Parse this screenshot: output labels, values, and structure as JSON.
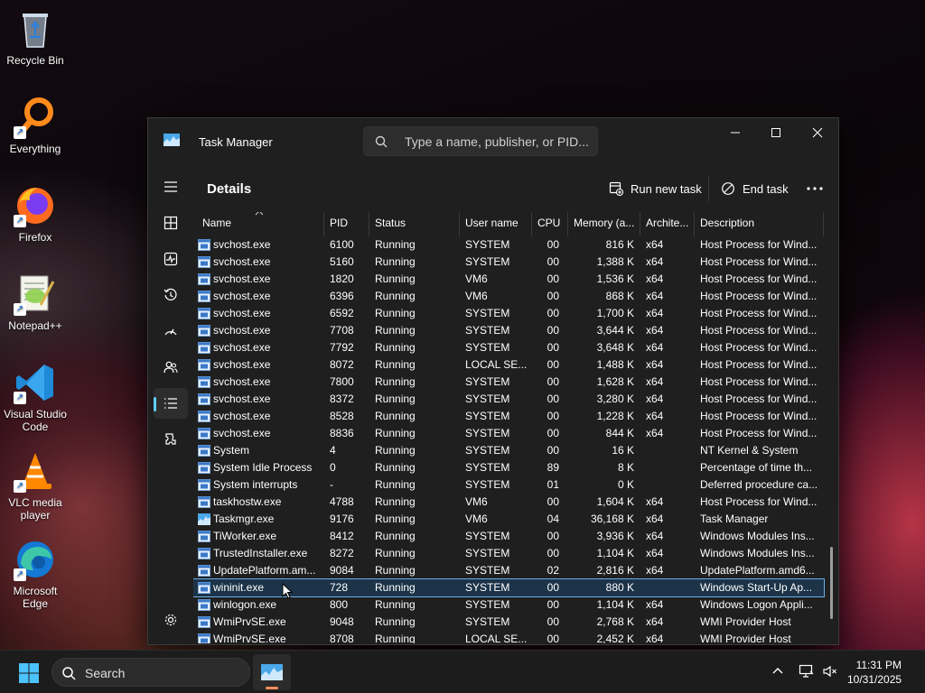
{
  "desktop": {
    "icons": [
      {
        "label": "Recycle Bin",
        "icon": "recycle-bin-icon"
      },
      {
        "label": "Everything",
        "icon": "everything-icon"
      },
      {
        "label": "Firefox",
        "icon": "firefox-icon"
      },
      {
        "label": "Notepad++",
        "icon": "notepad-plus-plus-icon"
      },
      {
        "label": "Visual Studio Code",
        "icon": "vscode-icon"
      },
      {
        "label": "VLC media player",
        "icon": "vlc-icon"
      },
      {
        "label": "Microsoft Edge",
        "icon": "edge-icon"
      }
    ]
  },
  "window": {
    "title": "Task Manager",
    "search_placeholder": "Type a name, publisher, or PID...",
    "page_title": "Details",
    "run_new_task_label": "Run new task",
    "end_task_label": "End task",
    "active_nav": "details"
  },
  "sidebar": {
    "items": [
      "hamburger-menu",
      "processes",
      "performance",
      "app-history",
      "startup-apps",
      "users",
      "details",
      "services",
      "settings"
    ]
  },
  "table": {
    "columns": [
      "Name",
      "PID",
      "Status",
      "User name",
      "CPU",
      "Memory (a...",
      "Archite...",
      "Description"
    ],
    "sorted_by": "Name",
    "rows": [
      {
        "name": "svchost.exe",
        "pid": "6100",
        "status": "Running",
        "user": "SYSTEM",
        "cpu": "00",
        "mem": "816 K",
        "arch": "x64",
        "desc": "Host Process for Wind..."
      },
      {
        "name": "svchost.exe",
        "pid": "5160",
        "status": "Running",
        "user": "SYSTEM",
        "cpu": "00",
        "mem": "1,388 K",
        "arch": "x64",
        "desc": "Host Process for Wind..."
      },
      {
        "name": "svchost.exe",
        "pid": "1820",
        "status": "Running",
        "user": "VM6",
        "cpu": "00",
        "mem": "1,536 K",
        "arch": "x64",
        "desc": "Host Process for Wind..."
      },
      {
        "name": "svchost.exe",
        "pid": "6396",
        "status": "Running",
        "user": "VM6",
        "cpu": "00",
        "mem": "868 K",
        "arch": "x64",
        "desc": "Host Process for Wind..."
      },
      {
        "name": "svchost.exe",
        "pid": "6592",
        "status": "Running",
        "user": "SYSTEM",
        "cpu": "00",
        "mem": "1,700 K",
        "arch": "x64",
        "desc": "Host Process for Wind..."
      },
      {
        "name": "svchost.exe",
        "pid": "7708",
        "status": "Running",
        "user": "SYSTEM",
        "cpu": "00",
        "mem": "3,644 K",
        "arch": "x64",
        "desc": "Host Process for Wind..."
      },
      {
        "name": "svchost.exe",
        "pid": "7792",
        "status": "Running",
        "user": "SYSTEM",
        "cpu": "00",
        "mem": "3,648 K",
        "arch": "x64",
        "desc": "Host Process for Wind..."
      },
      {
        "name": "svchost.exe",
        "pid": "8072",
        "status": "Running",
        "user": "LOCAL SE...",
        "cpu": "00",
        "mem": "1,488 K",
        "arch": "x64",
        "desc": "Host Process for Wind..."
      },
      {
        "name": "svchost.exe",
        "pid": "7800",
        "status": "Running",
        "user": "SYSTEM",
        "cpu": "00",
        "mem": "1,628 K",
        "arch": "x64",
        "desc": "Host Process for Wind..."
      },
      {
        "name": "svchost.exe",
        "pid": "8372",
        "status": "Running",
        "user": "SYSTEM",
        "cpu": "00",
        "mem": "3,280 K",
        "arch": "x64",
        "desc": "Host Process for Wind..."
      },
      {
        "name": "svchost.exe",
        "pid": "8528",
        "status": "Running",
        "user": "SYSTEM",
        "cpu": "00",
        "mem": "1,228 K",
        "arch": "x64",
        "desc": "Host Process for Wind..."
      },
      {
        "name": "svchost.exe",
        "pid": "8836",
        "status": "Running",
        "user": "SYSTEM",
        "cpu": "00",
        "mem": "844 K",
        "arch": "x64",
        "desc": "Host Process for Wind..."
      },
      {
        "name": "System",
        "pid": "4",
        "status": "Running",
        "user": "SYSTEM",
        "cpu": "00",
        "mem": "16 K",
        "arch": "",
        "desc": "NT Kernel & System"
      },
      {
        "name": "System Idle Process",
        "pid": "0",
        "status": "Running",
        "user": "SYSTEM",
        "cpu": "89",
        "mem": "8 K",
        "arch": "",
        "desc": "Percentage of time th..."
      },
      {
        "name": "System interrupts",
        "pid": "-",
        "status": "Running",
        "user": "SYSTEM",
        "cpu": "01",
        "mem": "0 K",
        "arch": "",
        "desc": "Deferred procedure ca..."
      },
      {
        "name": "taskhostw.exe",
        "pid": "4788",
        "status": "Running",
        "user": "VM6",
        "cpu": "00",
        "mem": "1,604 K",
        "arch": "x64",
        "desc": "Host Process for Wind..."
      },
      {
        "name": "Taskmgr.exe",
        "pid": "9176",
        "status": "Running",
        "user": "VM6",
        "cpu": "04",
        "mem": "36,168 K",
        "arch": "x64",
        "desc": "Task Manager"
      },
      {
        "name": "TiWorker.exe",
        "pid": "8412",
        "status": "Running",
        "user": "SYSTEM",
        "cpu": "00",
        "mem": "3,936 K",
        "arch": "x64",
        "desc": "Windows Modules Ins..."
      },
      {
        "name": "TrustedInstaller.exe",
        "pid": "8272",
        "status": "Running",
        "user": "SYSTEM",
        "cpu": "00",
        "mem": "1,104 K",
        "arch": "x64",
        "desc": "Windows Modules Ins..."
      },
      {
        "name": "UpdatePlatform.am...",
        "pid": "9084",
        "status": "Running",
        "user": "SYSTEM",
        "cpu": "02",
        "mem": "2,816 K",
        "arch": "x64",
        "desc": "UpdatePlatform.amd6..."
      },
      {
        "name": "wininit.exe",
        "pid": "728",
        "status": "Running",
        "user": "SYSTEM",
        "cpu": "00",
        "mem": "880 K",
        "arch": "",
        "desc": "Windows Start-Up Ap...",
        "selected": true
      },
      {
        "name": "winlogon.exe",
        "pid": "800",
        "status": "Running",
        "user": "SYSTEM",
        "cpu": "00",
        "mem": "1,104 K",
        "arch": "x64",
        "desc": "Windows Logon Appli..."
      },
      {
        "name": "WmiPrvSE.exe",
        "pid": "9048",
        "status": "Running",
        "user": "SYSTEM",
        "cpu": "00",
        "mem": "2,768 K",
        "arch": "x64",
        "desc": "WMI Provider Host"
      },
      {
        "name": "WmiPrvSE.exe",
        "pid": "8708",
        "status": "Running",
        "user": "LOCAL SE...",
        "cpu": "00",
        "mem": "2,452 K",
        "arch": "x64",
        "desc": "WMI Provider Host"
      }
    ]
  },
  "taskbar": {
    "search_label": "Search",
    "time": "11:31 PM",
    "date": "10/31/2025"
  },
  "colors": {
    "accent": "#60cdff",
    "selection_bg": "#1c3348",
    "selection_border": "#6ab0e6",
    "window_bg": "#1f1f1f"
  }
}
